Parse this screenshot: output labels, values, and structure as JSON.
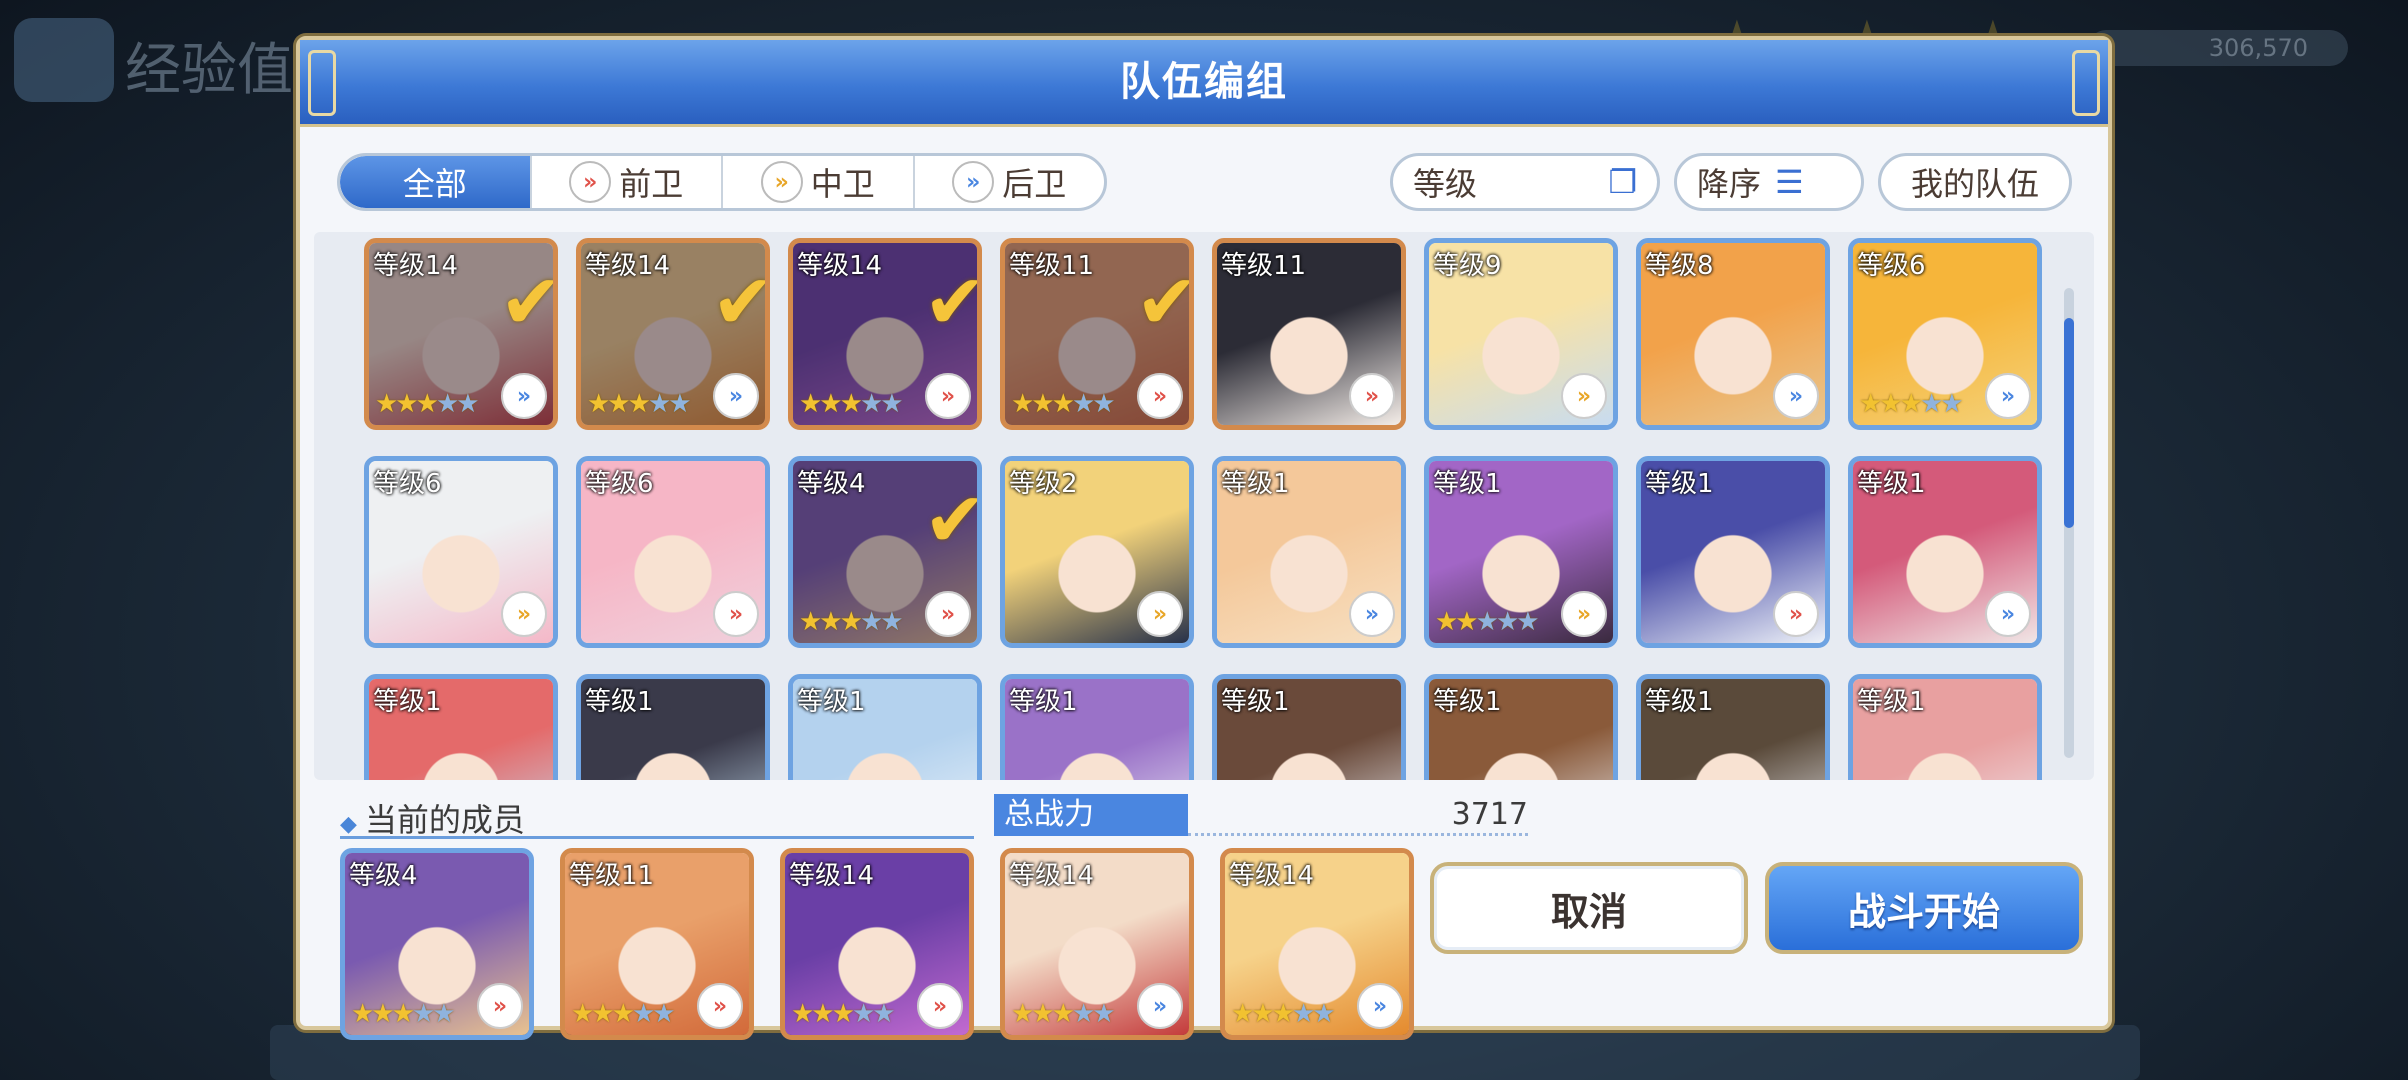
{
  "dialog": {
    "title": "队伍编组"
  },
  "filters": {
    "tabs": [
      {
        "label": "全部",
        "icon": ""
      },
      {
        "label": "前卫",
        "icon": "»"
      },
      {
        "label": "中卫",
        "icon": "»"
      },
      {
        "label": "后卫",
        "icon": "»"
      }
    ],
    "sort_field": "等级",
    "sort_order": "降序",
    "my_team": "我的队伍"
  },
  "roster": [
    {
      "level": "等级14",
      "stars": 3,
      "max_stars": 5,
      "role": "rear",
      "selected": true,
      "frame": "copper",
      "colors": [
        "#f3dcc8",
        "#c43b3b"
      ]
    },
    {
      "level": "等级14",
      "stars": 3,
      "max_stars": 5,
      "role": "rear",
      "selected": true,
      "frame": "copper",
      "colors": [
        "#f6d28a",
        "#e48a2e"
      ]
    },
    {
      "level": "等级14",
      "stars": 3,
      "max_stars": 5,
      "role": "front",
      "selected": true,
      "frame": "copper",
      "colors": [
        "#6a3fa6",
        "#c26ad0"
      ]
    },
    {
      "level": "等级11",
      "stars": 3,
      "max_stars": 5,
      "role": "front",
      "selected": true,
      "frame": "copper",
      "colors": [
        "#e9a06a",
        "#d26a3a"
      ]
    },
    {
      "level": "等级11",
      "stars": 0,
      "max_stars": 5,
      "role": "front",
      "selected": false,
      "frame": "copper",
      "colors": [
        "#2c2c36",
        "#f4ede8"
      ]
    },
    {
      "level": "等级9",
      "stars": 0,
      "max_stars": 5,
      "role": "mid",
      "selected": false,
      "frame": "blue",
      "colors": [
        "#f7e2a6",
        "#c8dcf0"
      ]
    },
    {
      "level": "等级8",
      "stars": 0,
      "max_stars": 5,
      "role": "rear",
      "selected": false,
      "frame": "blue",
      "colors": [
        "#f2a24a",
        "#e8c690"
      ]
    },
    {
      "level": "等级6",
      "stars": 3,
      "max_stars": 5,
      "role": "rear",
      "selected": false,
      "frame": "blue",
      "colors": [
        "#f6b53a",
        "#f4d27a"
      ]
    },
    {
      "level": "等级6",
      "stars": 0,
      "max_stars": 5,
      "role": "mid",
      "selected": false,
      "frame": "blue",
      "colors": [
        "#eef0f2",
        "#f4b8c8"
      ]
    },
    {
      "level": "等级6",
      "stars": 0,
      "max_stars": 5,
      "role": "front",
      "selected": false,
      "frame": "blue",
      "colors": [
        "#f6b6c6",
        "#f0d0dc"
      ]
    },
    {
      "level": "等级4",
      "stars": 3,
      "max_stars": 5,
      "role": "front",
      "selected": true,
      "frame": "blue",
      "colors": [
        "#7a5ab0",
        "#e8c290"
      ]
    },
    {
      "level": "等级2",
      "stars": 0,
      "max_stars": 5,
      "role": "mid",
      "selected": false,
      "frame": "blue",
      "colors": [
        "#f2d27a",
        "#27314a"
      ]
    },
    {
      "level": "等级1",
      "stars": 0,
      "max_stars": 5,
      "role": "rear",
      "selected": false,
      "frame": "blue",
      "colors": [
        "#f4c89a",
        "#f7e0c2"
      ]
    },
    {
      "level": "等级1",
      "stars": 2,
      "max_stars": 5,
      "role": "mid",
      "selected": false,
      "frame": "blue",
      "colors": [
        "#a266c6",
        "#3a2a3e"
      ]
    },
    {
      "level": "等级1",
      "stars": 0,
      "max_stars": 5,
      "role": "front",
      "selected": false,
      "frame": "blue",
      "colors": [
        "#4a4ea8",
        "#eef2f8"
      ]
    },
    {
      "level": "等级1",
      "stars": 0,
      "max_stars": 5,
      "role": "rear",
      "selected": false,
      "frame": "blue",
      "colors": [
        "#d45a7a",
        "#f0e6e6"
      ]
    },
    {
      "level": "等级1",
      "stars": 0,
      "max_stars": 5,
      "role": "rear",
      "selected": false,
      "frame": "blue",
      "colors": [
        "#e46a6a",
        "#c4dcee"
      ]
    },
    {
      "level": "等级1",
      "stars": 0,
      "max_stars": 5,
      "role": "front",
      "selected": false,
      "frame": "blue",
      "colors": [
        "#3a3a4a",
        "#c4dcee"
      ]
    },
    {
      "level": "等级1",
      "stars": 0,
      "max_stars": 5,
      "role": "front",
      "selected": false,
      "frame": "blue",
      "colors": [
        "#b4d2ee",
        "#eef4fa"
      ]
    },
    {
      "level": "等级1",
      "stars": 0,
      "max_stars": 5,
      "role": "mid",
      "selected": false,
      "frame": "blue",
      "colors": [
        "#9a72c8",
        "#eef0f6"
      ]
    },
    {
      "level": "等级1",
      "stars": 0,
      "max_stars": 5,
      "role": "mid",
      "selected": false,
      "frame": "blue",
      "colors": [
        "#6a4a3a",
        "#eef0f6"
      ]
    },
    {
      "level": "等级1",
      "stars": 0,
      "max_stars": 5,
      "role": "rear",
      "selected": false,
      "frame": "blue",
      "colors": [
        "#8a5a3a",
        "#eef0f6"
      ]
    },
    {
      "level": "等级1",
      "stars": 0,
      "max_stars": 5,
      "role": "rear",
      "selected": false,
      "frame": "blue",
      "colors": [
        "#5a4a3a",
        "#eef0f6"
      ]
    },
    {
      "level": "等级1",
      "stars": 0,
      "max_stars": 5,
      "role": "rear",
      "selected": false,
      "frame": "blue",
      "colors": [
        "#e8a0a0",
        "#eef0f6"
      ]
    }
  ],
  "members": {
    "label": "当前的成员",
    "power_label": "总战力",
    "power_value": "3717",
    "team": [
      {
        "level": "等级4",
        "stars": 3,
        "max_stars": 5,
        "role": "front",
        "frame": "blue",
        "colors": [
          "#7a5ab0",
          "#e8c290"
        ]
      },
      {
        "level": "等级11",
        "stars": 3,
        "max_stars": 5,
        "role": "front",
        "frame": "copper",
        "colors": [
          "#e9a06a",
          "#d26a3a"
        ]
      },
      {
        "level": "等级14",
        "stars": 3,
        "max_stars": 5,
        "role": "front",
        "frame": "copper",
        "colors": [
          "#6a3fa6",
          "#c26ad0"
        ]
      },
      {
        "level": "等级14",
        "stars": 3,
        "max_stars": 5,
        "role": "rear",
        "frame": "copper",
        "colors": [
          "#f3dcc8",
          "#c43b3b"
        ]
      },
      {
        "level": "等级14",
        "stars": 3,
        "max_stars": 5,
        "role": "rear",
        "frame": "copper",
        "colors": [
          "#f6d28a",
          "#e48a2e"
        ]
      }
    ]
  },
  "buttons": {
    "cancel": "取消",
    "start": "战斗开始"
  },
  "role_colors": {
    "front": "#e0524a",
    "mid": "#e8a628",
    "rear": "#4a86e0"
  },
  "background": {
    "title": "经验值",
    "coins": "306,570"
  }
}
